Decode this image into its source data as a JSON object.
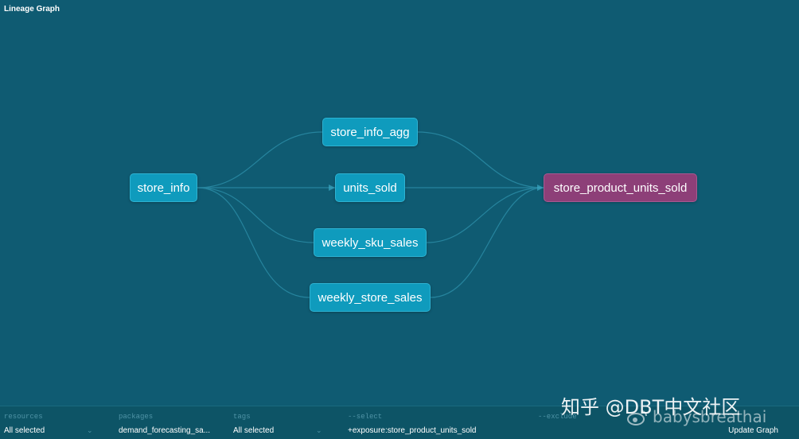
{
  "header": {
    "title": "Lineage Graph"
  },
  "graph": {
    "nodes": [
      {
        "id": "store_info",
        "label": "store_info"
      },
      {
        "id": "store_info_agg",
        "label": "store_info_agg"
      },
      {
        "id": "units_sold",
        "label": "units_sold"
      },
      {
        "id": "weekly_sku_sales",
        "label": "weekly_sku_sales"
      },
      {
        "id": "weekly_store_sales",
        "label": "weekly_store_sales"
      },
      {
        "id": "store_product_units_sold",
        "label": "store_product_units_sold"
      }
    ],
    "colors": {
      "background": "#0f5b72",
      "node": "#0f9bbd",
      "target_node": "#8d3f78",
      "edge": "#3aa7c2"
    }
  },
  "footer": {
    "resources": {
      "label": "resources",
      "value": "All selected"
    },
    "packages": {
      "label": "packages",
      "value": "demand_forecasting_sa..."
    },
    "tags": {
      "label": "tags",
      "value": "All selected"
    },
    "select": {
      "label": "--select",
      "value": "+exposure:store_product_units_sold"
    },
    "exclude": {
      "label": "--exclude",
      "value": ""
    },
    "update_label": "Update Graph",
    "chevron_icon": "chevron-down-icon"
  },
  "watermark": {
    "line1": "知乎 @DBT中文社区",
    "line2": "babysbreathai",
    "icon": "weibo-icon"
  }
}
